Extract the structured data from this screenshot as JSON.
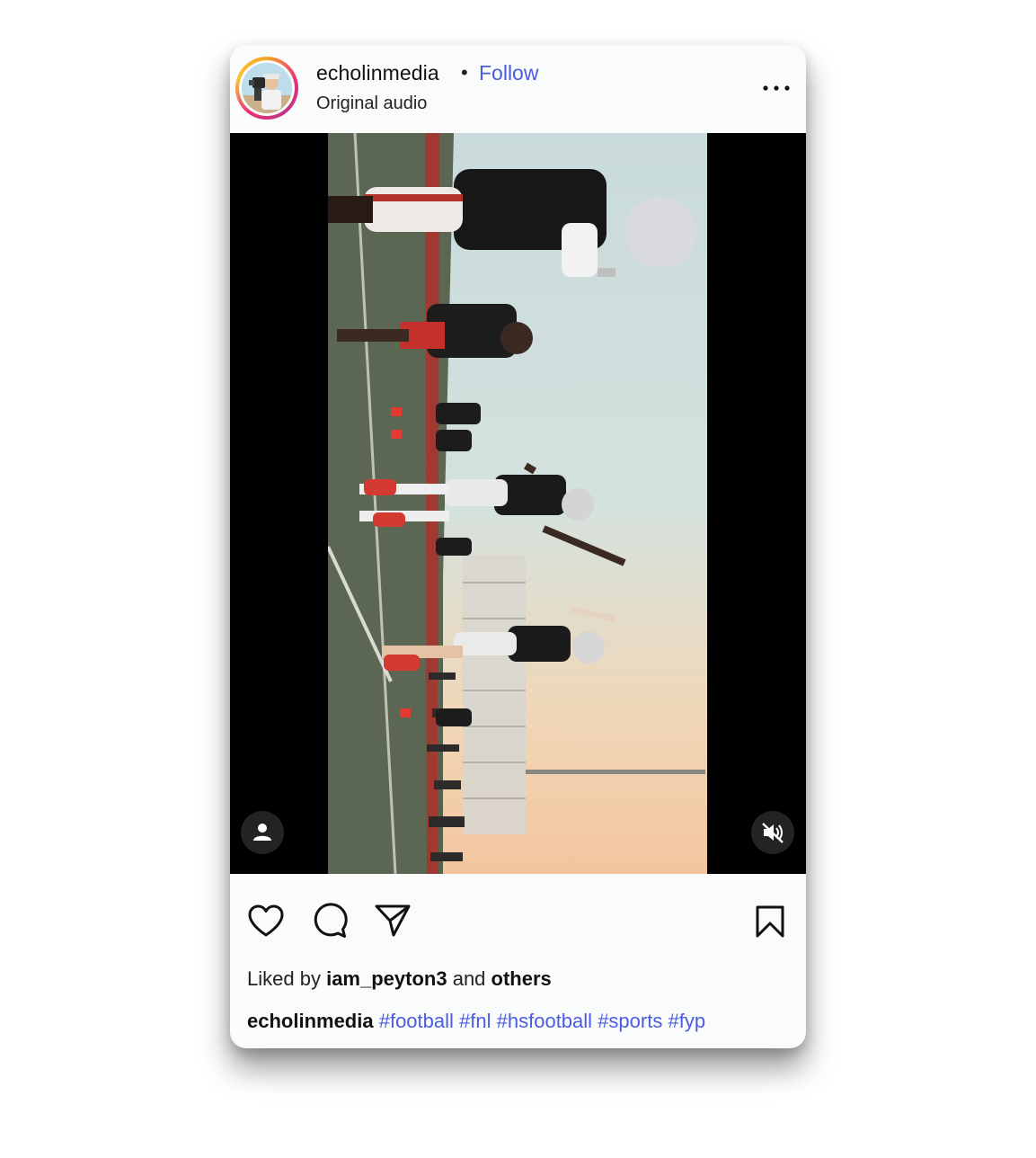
{
  "post": {
    "username": "echolinmedia",
    "separator": "•",
    "follow_label": "Follow",
    "audio_label": "Original audio",
    "more_icon": "more-horizontal-icon"
  },
  "media": {
    "tag_people_icon": "person-icon",
    "mute_icon": "muted-speaker-icon"
  },
  "actions": {
    "like_icon": "heart-icon",
    "comment_icon": "comment-bubble-icon",
    "share_icon": "paper-plane-icon",
    "save_icon": "bookmark-icon"
  },
  "likes": {
    "prefix": "Liked by",
    "user": "iam_peyton3",
    "middle": "and",
    "others": "others"
  },
  "caption": {
    "username": "echolinmedia",
    "hashtags": [
      "#football",
      "#fnl",
      "#hsfootball",
      "#sports",
      "#fyp"
    ]
  },
  "colors": {
    "link": "#4a5ce0",
    "text": "#111111"
  }
}
